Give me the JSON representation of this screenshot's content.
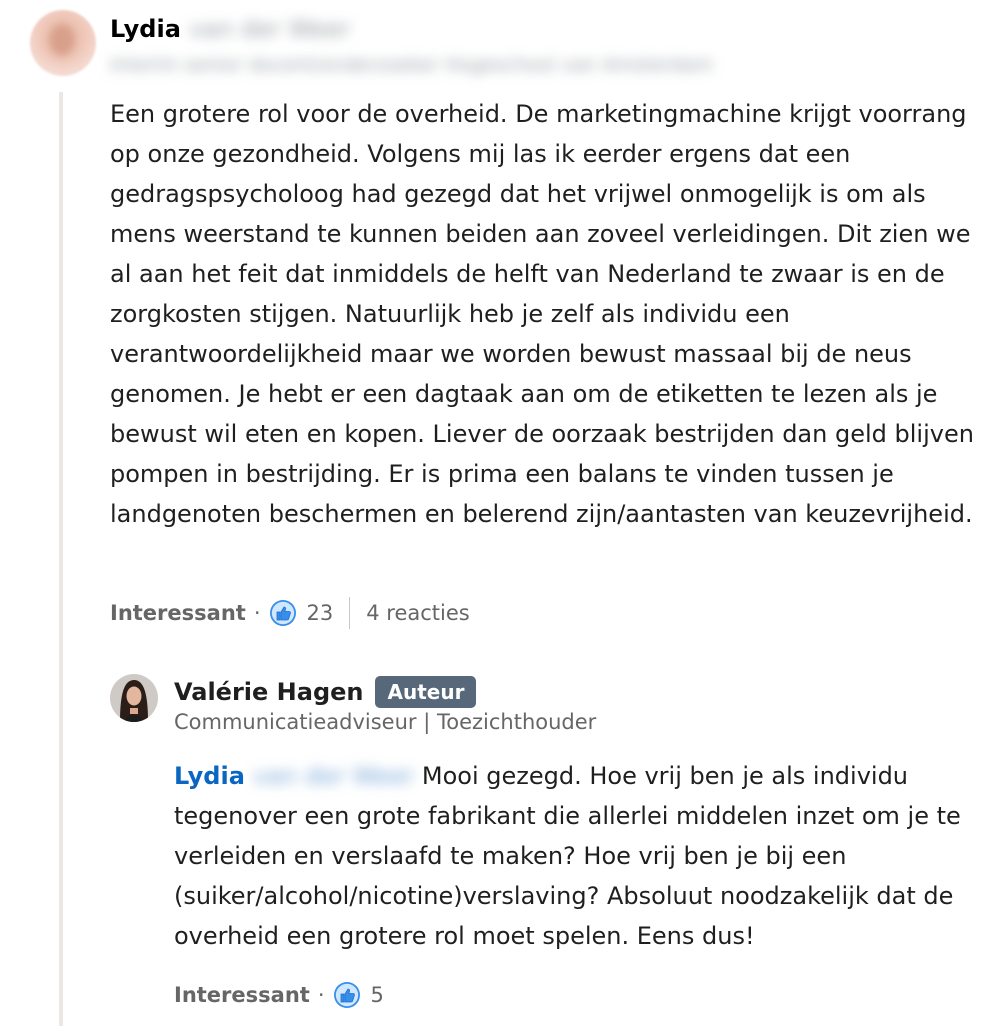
{
  "comment": {
    "author_first": "Lydia",
    "author_last_blurred": "van der Weer",
    "author_headline_blurred": "Interim senior docent/onderzoeker Hogeschool van Amsterdam",
    "text": "Een grotere rol voor de overheid. De marketingmachine krijgt voorrang op onze gezondheid. Volgens mij las ik eerder ergens dat een gedragspsycholoog had gezegd dat het vrijwel onmogelijk is om als mens weerstand te kunnen beiden aan zoveel verleidingen. Dit zien we al aan het feit dat inmiddels de helft van Nederland te zwaar is en de zorgkosten stijgen. Natuurlijk heb je zelf als individu een verantwoordelijkheid maar we worden bewust massaal bij de neus genomen. Je hebt er een dagtaak aan om de etiketten te lezen als je bewust wil eten en kopen. Liever de oorzaak bestrijden dan geld blijven pompen in bestrijding. Er is prima een balans te vinden tussen je landgenoten beschermen en belerend zijn/aantasten van keuzevrijheid.",
    "reaction_label": "Interessant",
    "separator": "·",
    "reaction_count": "23",
    "replies_label": "4 reacties",
    "like_icon": "like-icon"
  },
  "reply": {
    "author_name": "Valérie Hagen",
    "badge": "Auteur",
    "headline": "Communicatieadviseur | Toezichthouder",
    "mention_first": "Lydia",
    "mention_last_blurred": "van der Weer",
    "text": " Mooi gezegd. Hoe vrij ben je als individu tegenover een grote fabrikant die allerlei middelen inzet om je te verleiden en verslaafd te maken? Hoe vrij ben je bij een (suiker/alcohol/nicotine)verslaving? Absoluut noodzakelijk dat de overheid een grotere rol moet spelen. Eens dus!",
    "reaction_label": "Interessant",
    "separator": "·",
    "reaction_count": "5"
  },
  "colors": {
    "link": "#0a66c2",
    "badge_bg": "#56687a",
    "muted": "#666666",
    "thread_line": "#ebe7e2"
  }
}
